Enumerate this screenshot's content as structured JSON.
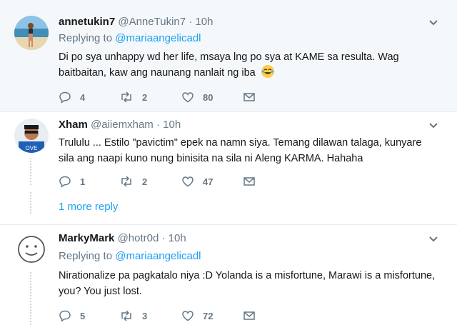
{
  "tweets": [
    {
      "name": "annetukin7",
      "handle": "@AnneTukin7",
      "time": "· 10h",
      "replying_prefix": "Replying to",
      "replying_to": "@mariaangelicadl",
      "text": "Di po sya unhappy wd her life, msaya lng po sya at KAME sa resulta. Wag baitbaitan, kaw ang naunang nanlait ng iba",
      "replies": "4",
      "retweets": "2",
      "likes": "80"
    },
    {
      "name": "Xham",
      "handle": "@aiiemxham",
      "time": "· 10h",
      "text": "Trululu ... Estilo \"pavictim\" epek na namn siya. Temang dilawan talaga, kunyare sila ang naapi kuno nung binisita na sila ni Aleng KARMA. Hahaha",
      "replies": "1",
      "retweets": "2",
      "likes": "47"
    },
    {
      "name": "MarkyMark",
      "handle": "@hotr0d",
      "time": "· 10h",
      "replying_prefix": "Replying to",
      "replying_to": "@mariaangelicadl",
      "text": "Nirationalize pa pagkatalo niya :D Yolanda is a misfortune, Marawi is a misfortune, you? You just lost.",
      "replies": "5",
      "retweets": "3",
      "likes": "72"
    }
  ],
  "more_replies": "1 more reply",
  "colors": {
    "accent": "#1da1f2",
    "muted": "#657786",
    "highlight_bg": "#f5f8fa",
    "separator": "#e6ecf0"
  },
  "icons": [
    "reply-icon",
    "retweet-icon",
    "like-icon",
    "direct-message-icon",
    "chevron-down-icon"
  ]
}
